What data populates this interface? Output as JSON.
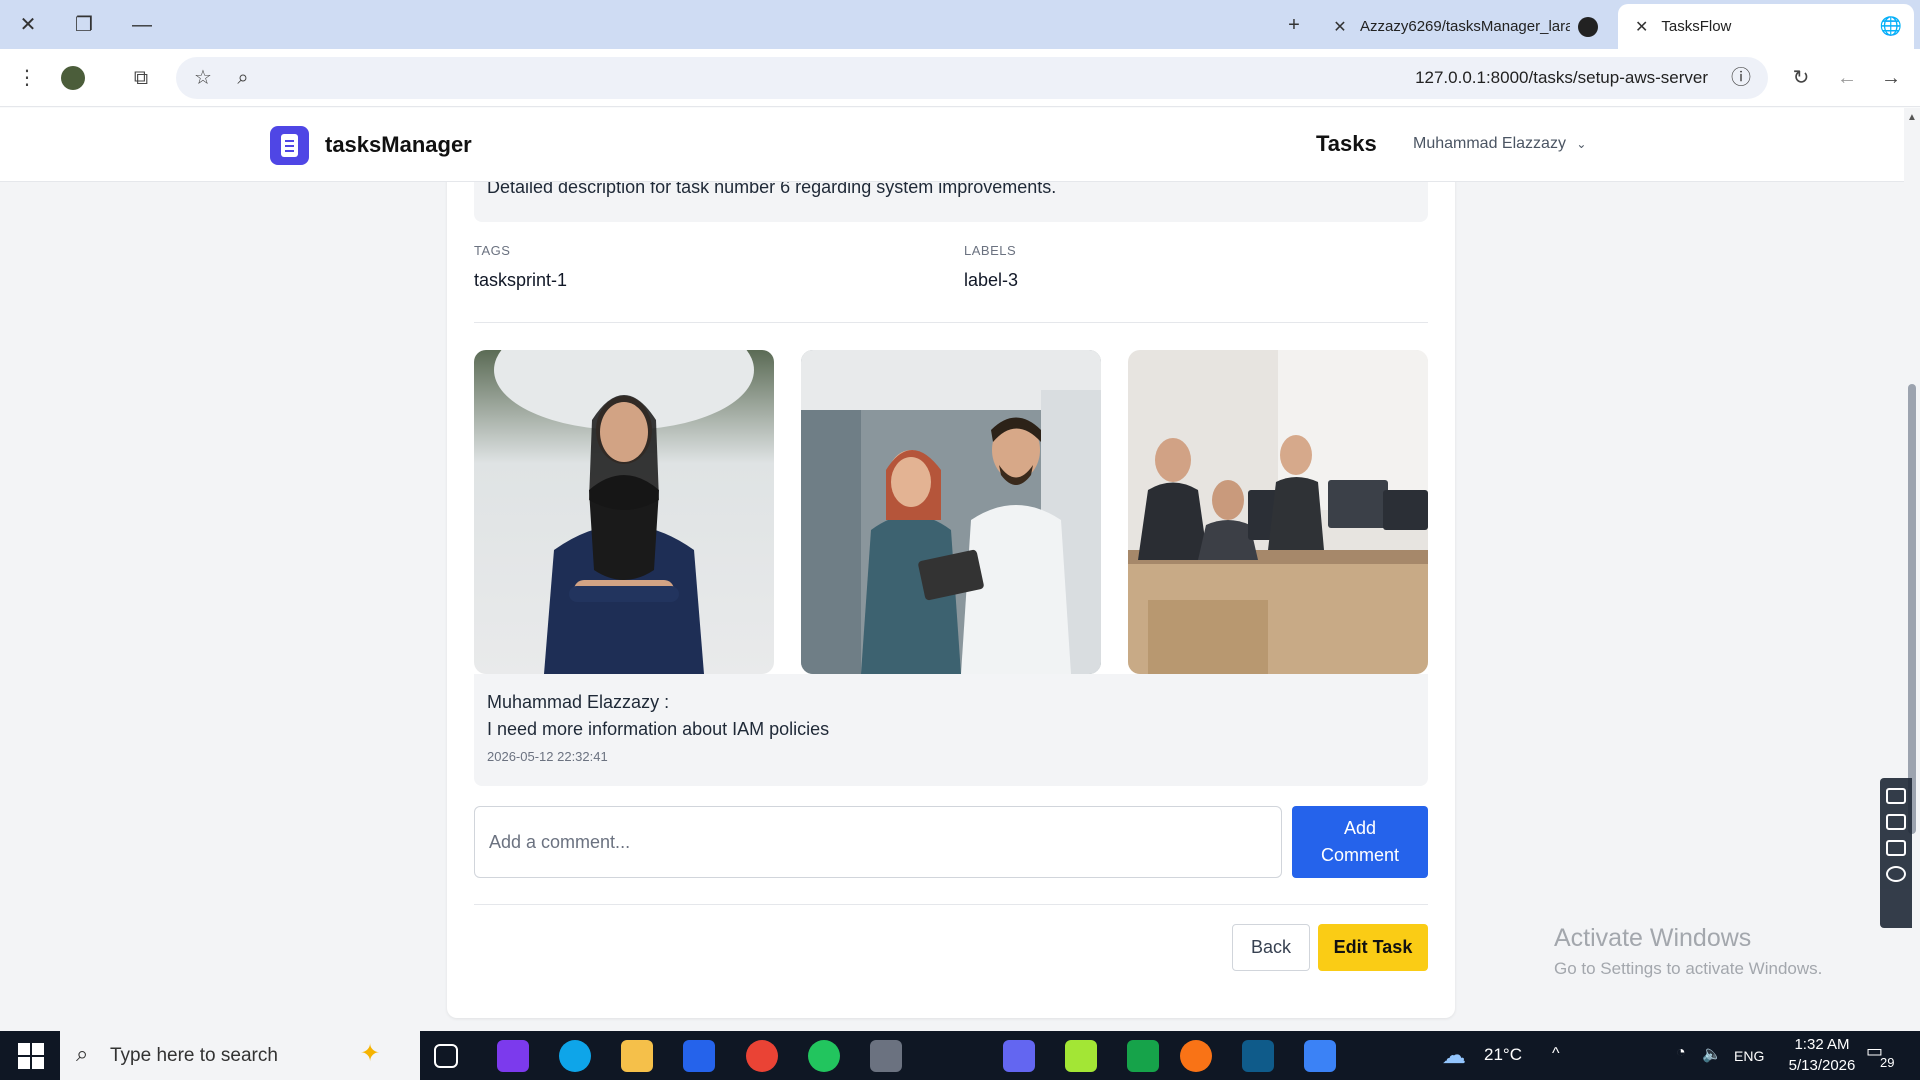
{
  "browser": {
    "tabs": [
      {
        "title": "Azzazy6269/tasksManager_lara",
        "active": false
      },
      {
        "title": "TasksFlow",
        "active": true
      }
    ],
    "url": "127.0.0.1:8000/tasks/setup-aws-server"
  },
  "navbar": {
    "brand": "tasksManager",
    "tasks_link": "Tasks",
    "user_name": "Muhammad Elazzazy"
  },
  "task": {
    "description": "Detailed description for task number 6 regarding system improvements.",
    "tags_label": "TAGS",
    "tags_value": "tasksprint-1",
    "labels_label": "LABELS",
    "labels_value": "label-3"
  },
  "comment": {
    "author": "Muhammad Elazzazy :",
    "text": "I need more information about IAM policies",
    "timestamp": "2026-05-12 22:32:41"
  },
  "comment_form": {
    "placeholder": "Add a comment...",
    "submit_label": "Add Comment"
  },
  "actions": {
    "back_label": "Back",
    "edit_label": "Edit Task"
  },
  "watermark": {
    "line1": "Activate Windows",
    "line2": "Go to Settings to activate Windows."
  },
  "taskbar": {
    "search_placeholder": "Type here to search",
    "temperature": "21°C",
    "language": "ENG",
    "time": "1:32 AM",
    "date": "5/13/2026",
    "notification_count": "29"
  },
  "colors": {
    "brand": "#4f46e5",
    "primary_button": "#2563eb",
    "edit_button": "#facc15"
  }
}
